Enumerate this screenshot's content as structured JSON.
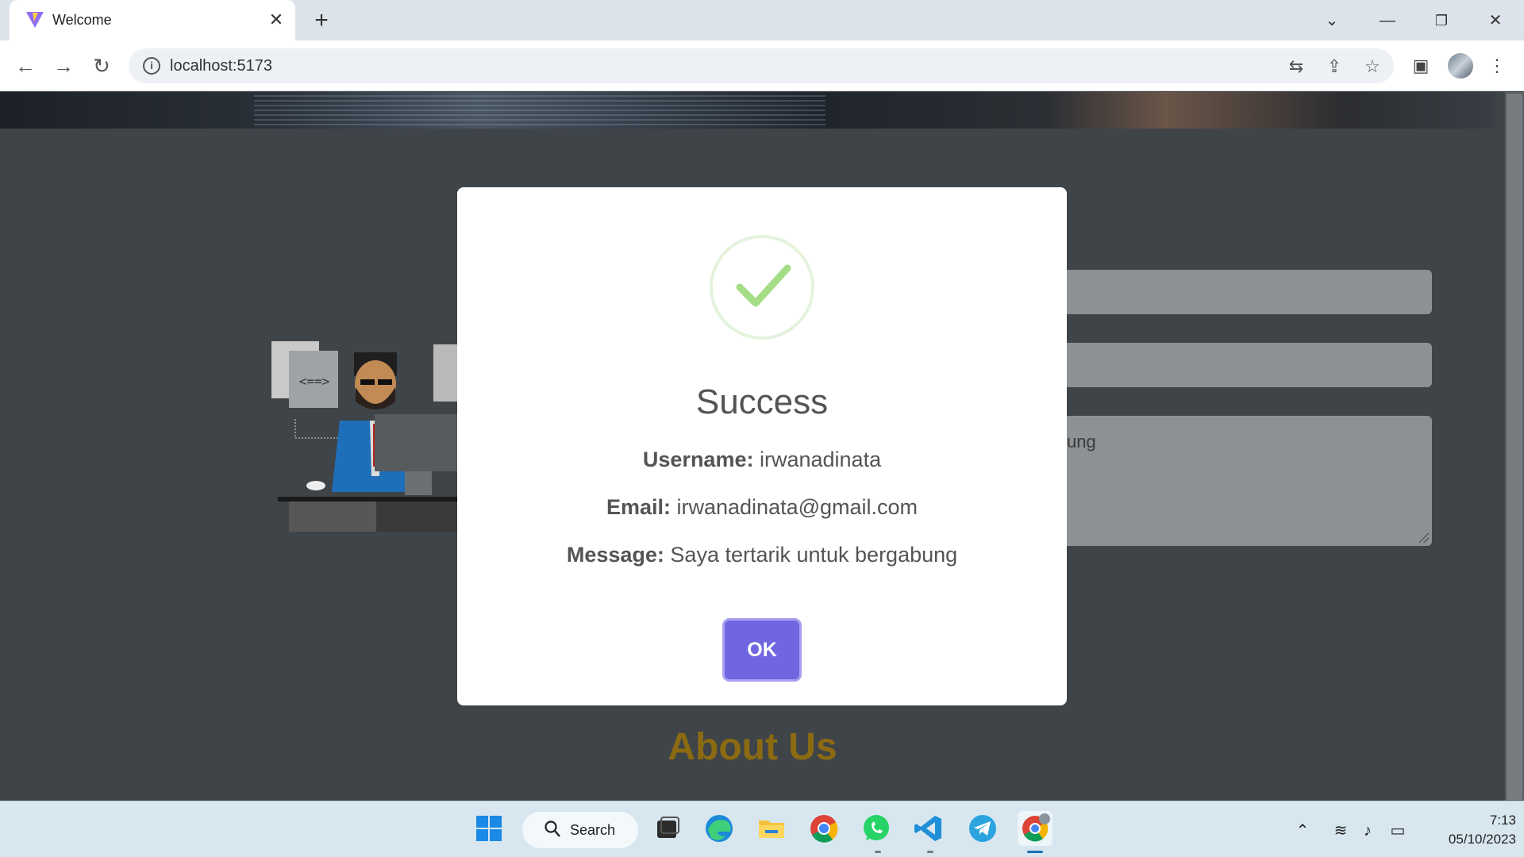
{
  "browser": {
    "tab_title": "Welcome",
    "url": "localhost:5173"
  },
  "page": {
    "message_field_value_fragment": "ung",
    "about_heading": "About Us"
  },
  "modal": {
    "title": "Success",
    "username_label": "Username:",
    "username_value": "irwanadinata",
    "email_label": "Email:",
    "email_value": "irwanadinata@gmail.com",
    "message_label": "Message:",
    "message_value": "Saya tertarik untuk bergabung",
    "ok_label": "OK"
  },
  "taskbar": {
    "search_label": "Search",
    "time": "7:13",
    "date": "05/10/2023"
  },
  "colors": {
    "modal_confirm": "#7066e0",
    "success_check": "#a5dc86",
    "about_heading": "#8c6a11"
  }
}
